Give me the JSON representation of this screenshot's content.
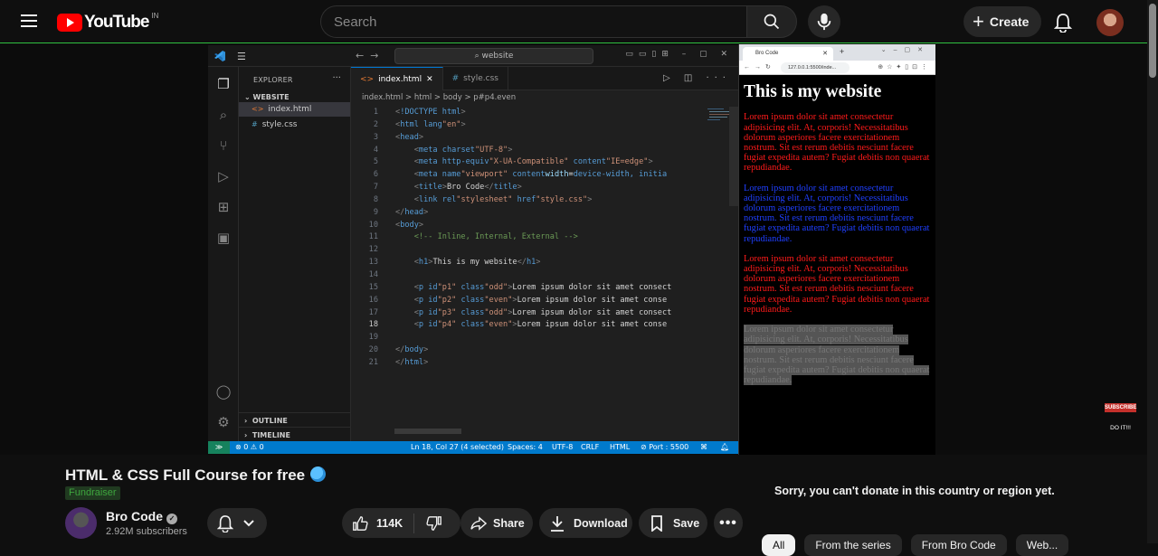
{
  "youtube": {
    "logo_text": "YouTube",
    "logo_region": "IN",
    "search_placeholder": "Search",
    "create_label": "Create"
  },
  "vscode": {
    "search_text": "website",
    "explorer_label": "EXPLORER",
    "folder_name": "WEBSITE",
    "files": [
      "index.html",
      "style.css"
    ],
    "outline_label": "OUTLINE",
    "timeline_label": "TIMELINE",
    "tabs": [
      "index.html",
      "style.css"
    ],
    "breadcrumb": "index.html > html > body > p#p4.even",
    "code_lines": [
      "<!DOCTYPE html>",
      "<html lang=\"en\">",
      "<head>",
      "    <meta charset=\"UTF-8\">",
      "    <meta http-equiv=\"X-UA-Compatible\" content=\"IE=edge\">",
      "    <meta name=\"viewport\" content=\"width=device-width, initia",
      "    <title>Bro Code</title>",
      "    <link rel=\"stylesheet\" href=\"style.css\">",
      "</head>",
      "<body>",
      "    <!-- Inline, Internal, External -->",
      "",
      "    <h1>This is my website</h1>",
      "",
      "    <p id=\"p1\" class=\"odd\">Lorem ipsum dolor sit amet consect",
      "    <p id=\"p2\" class=\"even\">Lorem ipsum dolor sit amet conse",
      "    <p id=\"p3\" class=\"odd\">Lorem ipsum dolor sit amet consect",
      "    <p id=\"p4\" class=\"even\">Lorem ipsum dolor sit amet conse",
      "",
      "</body>",
      "</html>"
    ],
    "current_line": 18,
    "status": {
      "errors": "⊗ 0 ⚠ 0",
      "position": "Ln 18, Col 27 (4 selected)",
      "spaces": "Spaces: 4",
      "encoding": "UTF-8",
      "eol": "CRLF",
      "language": "HTML",
      "port": "⊘ Port : 5500"
    }
  },
  "browser": {
    "tab_title": "Bro Code",
    "url": "127.0.0.1:5500/inde...",
    "heading": "This is my website",
    "paragraph": "Lorem ipsum dolor sit amet consectetur adipisicing elit. At, corporis! Necessitatibus dolorum asperiores facere exercitationem nostrum. Sit est rerum debitis nesciunt facere fugiat expedita autem? Fugiat debitis non quaerat repudiandae.",
    "colors": {
      "odd": "#ff1a1a",
      "even_p2": "#1f3fff",
      "even_p4": "#777777"
    }
  },
  "badge": {
    "top": "SUBSCRIBE",
    "bottom": "DO IT!!!"
  },
  "video": {
    "title": "HTML & CSS Full Course for free",
    "fundraiser": "Fundraiser",
    "channel": "Bro Code",
    "subscribers": "2.92M subscribers",
    "likes": "114K",
    "share": "Share",
    "download": "Download",
    "save": "Save",
    "donate_message": "Sorry, you can't donate in this country or region yet."
  },
  "chips": [
    "All",
    "From the series",
    "From Bro Code",
    "Web..."
  ]
}
